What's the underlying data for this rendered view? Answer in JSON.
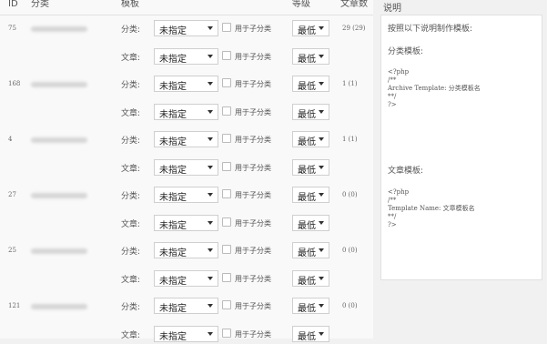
{
  "headers": {
    "id": "ID",
    "category": "分类",
    "template": "模板",
    "level": "等级",
    "article_count": "文章数",
    "description": "说明"
  },
  "row_labels": {
    "category": "分类:",
    "article": "文章:"
  },
  "select": {
    "template_value": "未指定",
    "level_value": "最低"
  },
  "checkbox_label": "用于子分类",
  "rows": [
    {
      "id": "75",
      "count": "29 (29)"
    },
    {
      "id": "168",
      "count": "1 (1)"
    },
    {
      "id": "4",
      "count": "1 (1)"
    },
    {
      "id": "27",
      "count": "0 (0)"
    },
    {
      "id": "25",
      "count": "0 (0)"
    },
    {
      "id": "121",
      "count": "0 (0)"
    }
  ],
  "sidebar": {
    "intro": "按照以下说明制作模板:",
    "category_title": "分类模板:",
    "category_code": [
      "<?php",
      "/**",
      "Archive Template: 分类模板名",
      "**/",
      "?>"
    ],
    "article_title": "文章模板:",
    "article_code": [
      "<?php",
      "/**",
      "Template Name: 文章模板名",
      "**/",
      "?>"
    ]
  }
}
